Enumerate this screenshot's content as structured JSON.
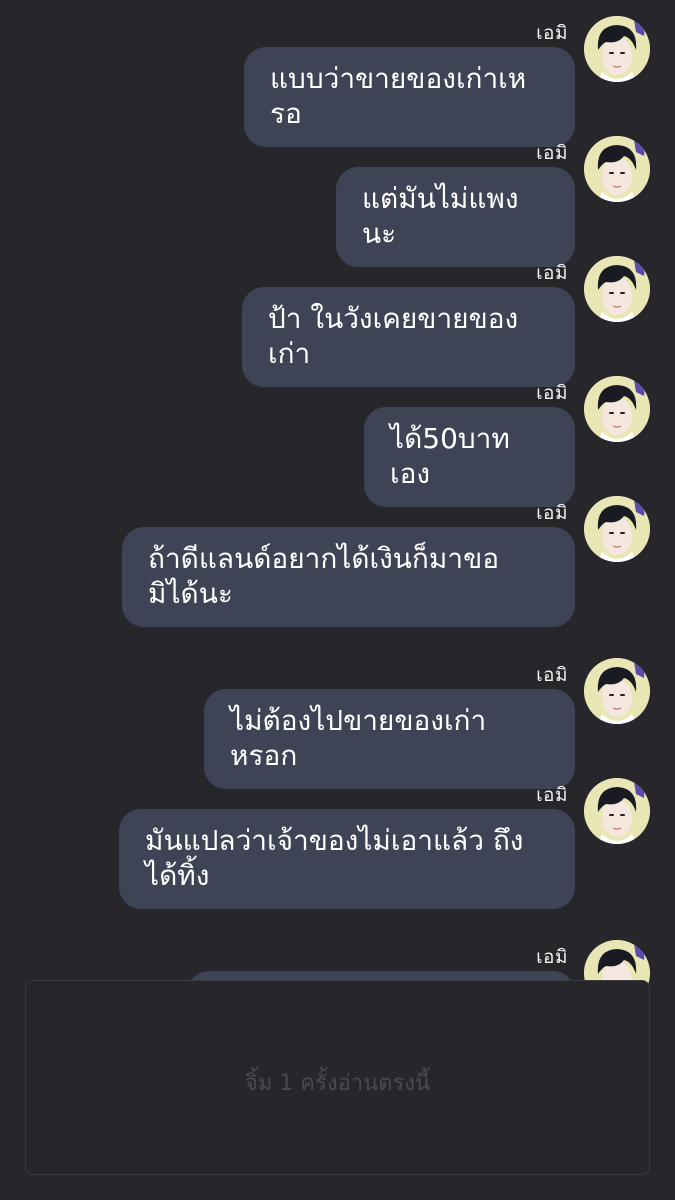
{
  "colors": {
    "background": "#26262b",
    "bubble": "#3e4455",
    "bubble_text": "#ffffff",
    "sender_text": "#f2f2f2",
    "avatar_bg": "#e9e6b5",
    "placeholder_text": "#4a4a52"
  },
  "messages": [
    {
      "sender": "เอมิ",
      "text": "แบบว่าขายของเก่าเหรอ"
    },
    {
      "sender": "เอมิ",
      "text": "แต่มันไม่แพงนะ"
    },
    {
      "sender": "เอมิ",
      "text": "ป้า ในวังเคยขายของเก่า"
    },
    {
      "sender": "เอมิ",
      "text": "ได้50บาทเอง"
    },
    {
      "sender": "เอมิ",
      "text": "ถ้าดีแลนด์อยากได้เงินก็มาขอมิได้นะ"
    },
    {
      "sender": "เอมิ",
      "text": "ไม่ต้องไปขายของเก่าหรอก"
    },
    {
      "sender": "เอมิ",
      "text": "มันแปลว่าเจ้าของไม่เอาแล้ว ถึงได้ทิ้ง"
    },
    {
      "sender": "เอมิ",
      "text": ""
    }
  ],
  "avatar_icon": "profile-photo",
  "input": {
    "placeholder": "จิ้ม 1 ครั้งอ่านตรงนี้"
  }
}
